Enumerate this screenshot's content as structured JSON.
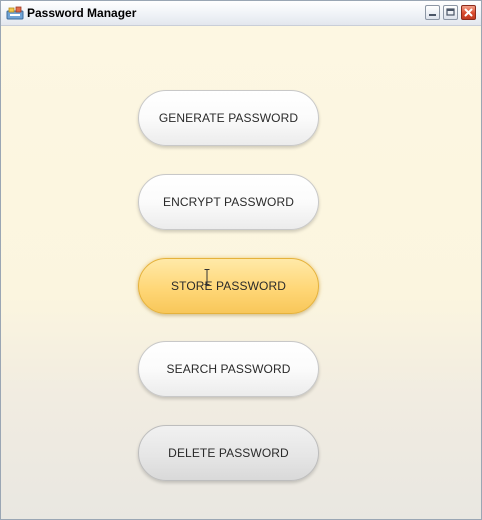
{
  "window": {
    "title": "Password Manager",
    "icon": "app-icon",
    "controls": [
      "minimize-icon",
      "maximize-icon",
      "close-icon"
    ]
  },
  "buttons": [
    {
      "label": "GENERATE PASSWORD",
      "state": "normal"
    },
    {
      "label": "ENCRYPT PASSWORD",
      "state": "normal"
    },
    {
      "label": "STORE PASSWORD",
      "state": "hover"
    },
    {
      "label": "SEARCH PASSWORD",
      "state": "normal"
    },
    {
      "label": "DELETE PASSWORD",
      "state": "normal"
    }
  ],
  "colors": {
    "background": "#fdf6e0",
    "button_highlight": "#ffd777",
    "button_text": "#2a2a2a"
  }
}
